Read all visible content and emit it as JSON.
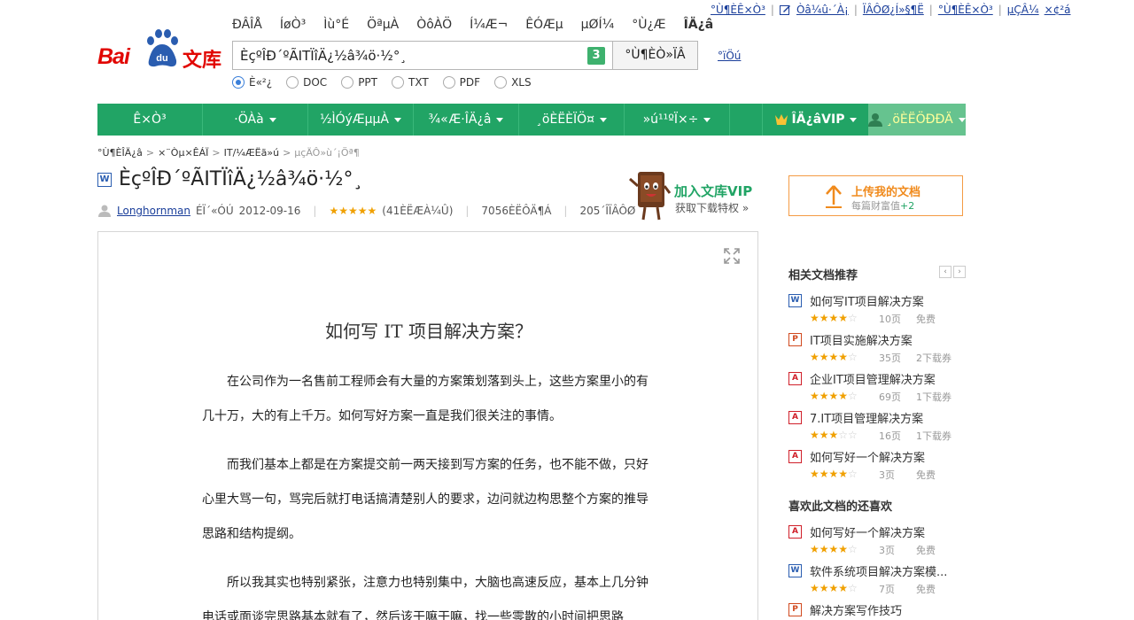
{
  "top_nav": [
    {
      "label": "ÐÂÎÅ",
      "active": false
    },
    {
      "label": "ÍøÒ³",
      "active": false
    },
    {
      "label": "Ìù°É",
      "active": false
    },
    {
      "label": "ÖªµÀ",
      "active": false
    },
    {
      "label": "ÒôÀÖ",
      "active": false
    },
    {
      "label": "Í¼Æ¬",
      "active": false
    },
    {
      "label": "ÊÓÆµ",
      "active": false
    },
    {
      "label": "µØÍ¼",
      "active": false
    },
    {
      "label": "°Ù¿Æ",
      "active": false
    },
    {
      "label": "ÎÄ¿â",
      "active": true
    }
  ],
  "user_links": {
    "home": "°Ù¶ÈÊ×Ò³",
    "edit": "Òâ¼û·´À¡",
    "setting": "ÏÂÔØ¿Í»§¶Ë",
    "help": "°Ù¶ÈÊ×Ò³",
    "login": "µÇÂ¼",
    "register": "×¢²á"
  },
  "logo": {
    "bai": "Bai",
    "du": "du",
    "wenku": "文库"
  },
  "search": {
    "value": "ÈçºÎÐ´ºÃITÏîÄ¿½â¾ö·½°¸",
    "badge": "3",
    "button": "°Ù¶ÈÒ»ÏÂ",
    "help": "°ïÖú"
  },
  "filters": [
    {
      "label": "È«²¿",
      "on": true
    },
    {
      "label": "DOC",
      "on": false
    },
    {
      "label": "PPT",
      "on": false
    },
    {
      "label": "TXT",
      "on": false
    },
    {
      "label": "PDF",
      "on": false
    },
    {
      "label": "XLS",
      "on": false
    }
  ],
  "green_menu": {
    "items": [
      {
        "label": "Ê×Ò³",
        "caret": false
      },
      {
        "label": "·ÖÀà",
        "caret": true
      },
      {
        "label": "½ÌÓýÆµµÀ",
        "caret": true
      },
      {
        "label": "¾«Æ·ÎÄ¿â",
        "caret": true
      },
      {
        "label": "¸öÈËÈÏÖ¤",
        "caret": true
      },
      {
        "label": "»ú¹¹ºÏ×÷",
        "caret": true
      }
    ],
    "vip": "ÎÄ¿âVIP",
    "user": "¸öÈËÖÐÐÄ"
  },
  "breadcrumb": {
    "items": [
      "°Ù¶ÈÎÄ¿â",
      "×¨Òµ×ÊÁÏ",
      "IT/¼ÆËã»ú"
    ],
    "current": "µçÄÔ»ù´¡Öª¶"
  },
  "doc": {
    "title": "ÈçºÎÐ´ºÃITÏîÄ¿½â¾ö·½°¸",
    "author": "Longhornman",
    "shared_label": "ÉÏ´«ÓÚ",
    "date": "2012-09-16",
    "rating": 4.5,
    "ratings_count": "(41ÈËÆÀ¼Û)",
    "reads": "7056ÈËÔÄ¶Á",
    "downloads": "205´ÎÏÂÔØ",
    "heading": "如何写 IT 项目解决方案？",
    "paragraphs": [
      "在公司作为一名售前工程师会有大量的方案策划落到头上，这些方案里小的有几十万，大的有上千万。如何写好方案一直是我们很关注的事情。",
      "而我们基本上都是在方案提交前一两天接到写方案的任务，也不能不做，只好心里大骂一句，骂完后就打电话搞清楚别人的要求，边问就边构思整个方案的推导思路和结构提纲。",
      "所以我其实也特别紧张，注意力也特别集中，大脑也高速反应，基本上几分钟电话或面谈完思路基本就有了，然后该干嘛干嘛，找一些零散的小时间把思路"
    ]
  },
  "vip_promo": {
    "title": "加入文库VIP",
    "subtitle": "获取下载特权 »"
  },
  "upload": {
    "title": "上传我的文档",
    "subtitle": "每篇财富值",
    "plus": "+2"
  },
  "related": {
    "heading": "相关文档推荐",
    "items": [
      {
        "icon": "W",
        "type": "w",
        "title": "如何写IT项目解决方案",
        "rating": 4,
        "pages": "10页",
        "cost": "免费"
      },
      {
        "icon": "P",
        "type": "p",
        "title": "IT项目实施解决方案",
        "rating": 4,
        "pages": "35页",
        "cost": "2下载券"
      },
      {
        "icon": "A",
        "type": "pdf",
        "title": "企业IT项目管理解决方案",
        "rating": 4,
        "pages": "69页",
        "cost": "1下载券"
      },
      {
        "icon": "A",
        "type": "pdf",
        "title": "7.IT项目管理解决方案",
        "rating": 3,
        "pages": "16页",
        "cost": "1下载券"
      },
      {
        "icon": "A",
        "type": "pdf",
        "title": "如何写好一个解决方案",
        "rating": 4,
        "pages": "3页",
        "cost": "免费"
      }
    ]
  },
  "also_like": {
    "heading": "喜欢此文档的还喜欢",
    "items": [
      {
        "icon": "A",
        "type": "pdf",
        "title": "如何写好一个解决方案",
        "rating": 4,
        "pages": "3页",
        "cost": "免费"
      },
      {
        "icon": "W",
        "type": "w",
        "title": "软件系统项目解决方案模...",
        "rating": 4,
        "pages": "7页",
        "cost": "免费"
      },
      {
        "icon": "P",
        "type": "p",
        "title": "解决方案写作技巧",
        "rating": 4,
        "pages": "",
        "cost": ""
      }
    ]
  },
  "colors": {
    "green": "#21a465",
    "baidu_red": "#e10601",
    "link_blue": "#1a3e9a",
    "star": "#f0a000",
    "orange": "#f08a1c"
  }
}
